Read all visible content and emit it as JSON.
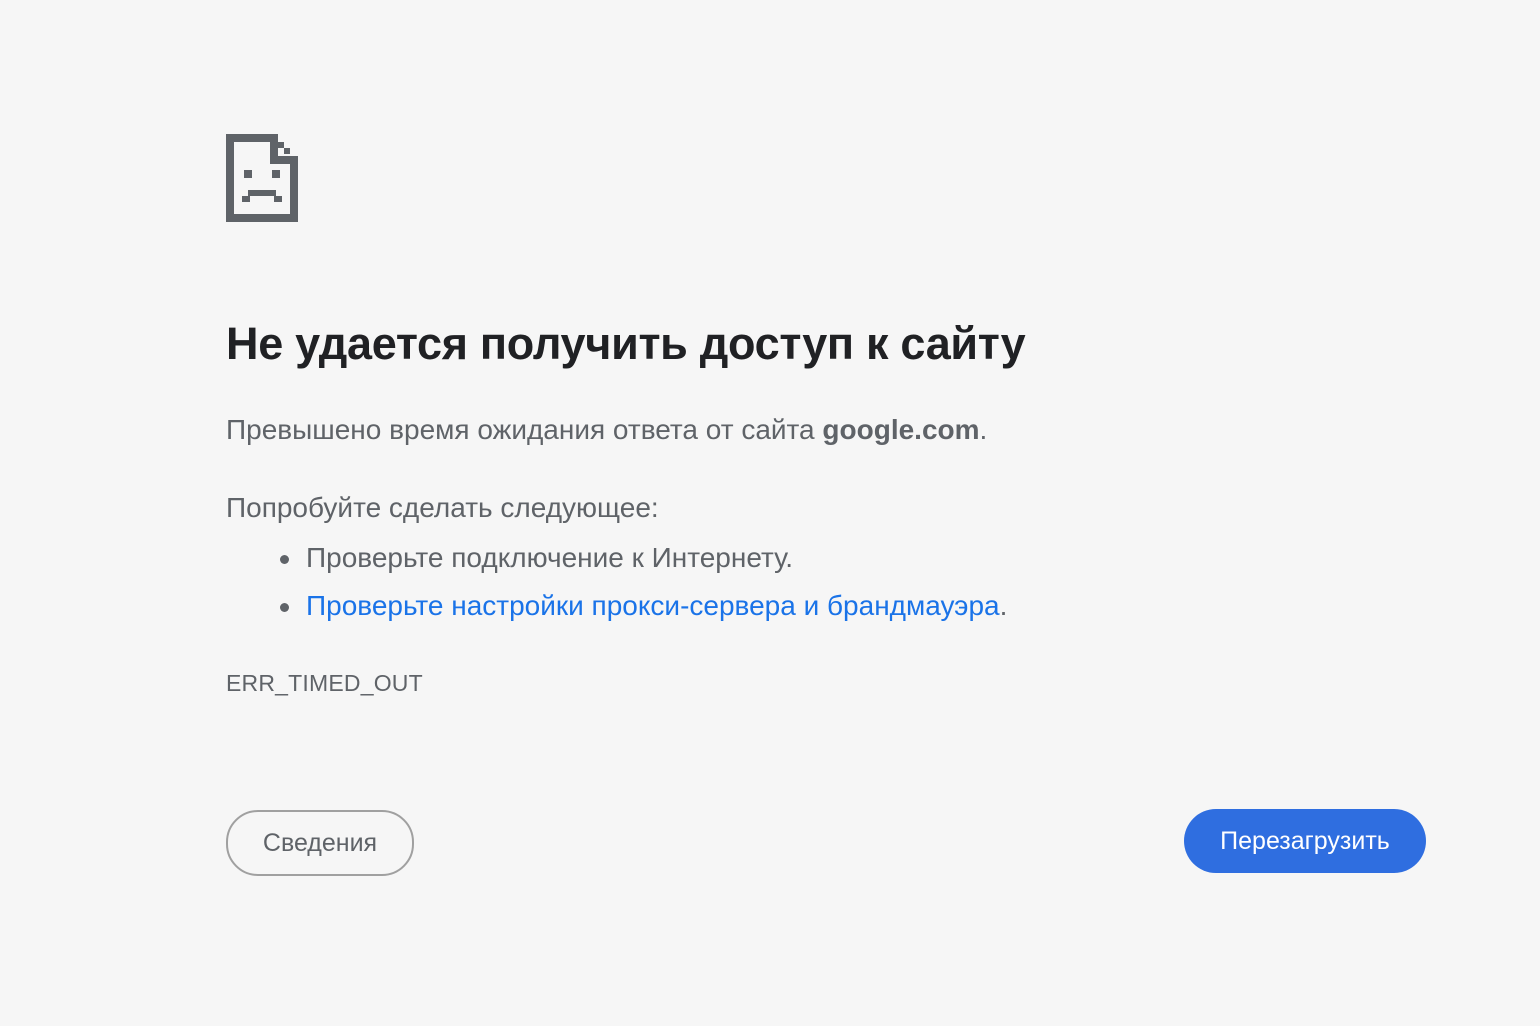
{
  "icon": "sad-page-icon",
  "title": "Не удается получить доступ к сайту",
  "summary": {
    "prefix": "Превышено время ожидания ответа от сайта ",
    "host": "google.com",
    "suffix": "."
  },
  "suggestions": {
    "heading": "Попробуйте сделать следующее:",
    "items": [
      {
        "text": "Проверьте подключение к Интернету.",
        "link": false
      },
      {
        "text": "Проверьте настройки прокси-сервера и брандмауэра",
        "suffix": ".",
        "link": true
      }
    ]
  },
  "error_code": "ERR_TIMED_OUT",
  "buttons": {
    "details_label": "Сведения",
    "reload_label": "Перезагрузить"
  },
  "colors": {
    "background": "#f6f6f6",
    "title": "#202124",
    "text": "#5f6368",
    "link": "#1a73e8",
    "primary_button": "#2f6ee0"
  }
}
